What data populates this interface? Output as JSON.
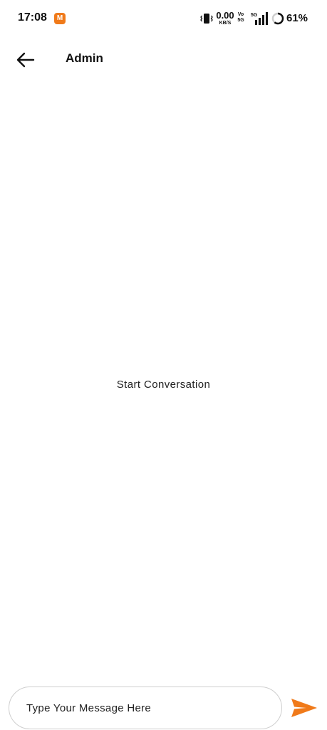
{
  "status_bar": {
    "time": "17:08",
    "app_badge": "M",
    "net_speed_value": "0.00",
    "net_speed_unit": "KB/S",
    "vo_label": "Vo",
    "fiveg_label": "5G",
    "signal_label": "5G",
    "battery_percent": "61%",
    "battery_level": 0.61
  },
  "app_bar": {
    "title": "Admin",
    "back_icon": "arrow-left-icon"
  },
  "conversation": {
    "empty_message": "Start Conversation"
  },
  "composer": {
    "placeholder": "Type Your Message Here",
    "value": "",
    "send_icon": "send-icon"
  },
  "colors": {
    "accent": "#f07a1a",
    "background": "#ffffff",
    "text": "#111111"
  }
}
